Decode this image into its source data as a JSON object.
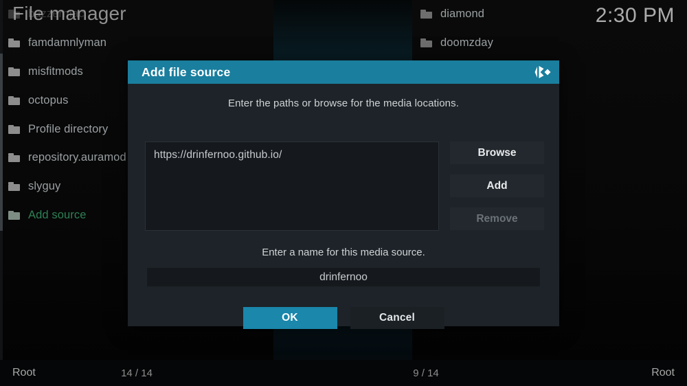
{
  "window": {
    "title": "File manager",
    "clock": "2:30 PM"
  },
  "left_pane": {
    "items": [
      {
        "label": "bazzermac",
        "state": "obscured"
      },
      {
        "label": "famdamnlyman",
        "state": "normal"
      },
      {
        "label": "misfitmods",
        "state": "normal"
      },
      {
        "label": "octopus",
        "state": "normal"
      },
      {
        "label": "Profile directory",
        "state": "normal"
      },
      {
        "label": "repository.auramod",
        "state": "normal"
      },
      {
        "label": "slyguy",
        "state": "normal"
      },
      {
        "label": "Add source",
        "state": "selected"
      }
    ]
  },
  "right_pane": {
    "items": [
      {
        "label": "diamond",
        "state": "normal"
      },
      {
        "label": "doomzday",
        "state": "normal"
      }
    ]
  },
  "statusbar": {
    "left_path": "Root",
    "left_count": "14 / 14",
    "right_count": "9 / 14",
    "right_path": "Root"
  },
  "dialog": {
    "title": "Add file source",
    "logo_icon": "kodi-logo-icon",
    "path_hint": "Enter the paths or browse for the media locations.",
    "path_value": "https://drinfernoo.github.io/",
    "buttons": {
      "browse": "Browse",
      "add": "Add",
      "remove": "Remove"
    },
    "name_hint": "Enter a name for this media source.",
    "name_value": "drinfernoo",
    "ok": "OK",
    "cancel": "Cancel"
  },
  "colors": {
    "accent": "#1a87ab",
    "title_bar": "#1a7e9e",
    "selected_green": "#2e8055",
    "dialog_bg": "#1d2328",
    "field_bg": "#15191d"
  }
}
